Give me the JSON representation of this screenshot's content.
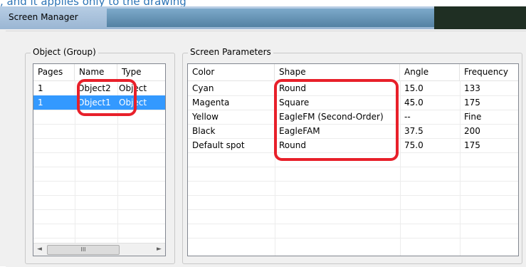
{
  "top_text": ", and it applies only to the drawing",
  "window": {
    "title": "Screen Manager"
  },
  "object_group": {
    "legend": "Object (Group)",
    "columns": [
      "Pages",
      "Name",
      "Type"
    ],
    "rows": [
      {
        "pages": "1",
        "name": "Object2",
        "type": "Object",
        "selected": false
      },
      {
        "pages": "1",
        "name": "Object1",
        "type": "Object",
        "selected": true
      }
    ],
    "scrollbar": {
      "left_arrow": "◄",
      "right_arrow": "►",
      "thumb_grip": "III"
    }
  },
  "screen_parameters": {
    "legend": "Screen Parameters",
    "columns": [
      "Color",
      "Shape",
      "Angle",
      "Frequency"
    ],
    "rows": [
      {
        "color": "Cyan",
        "shape": "Round",
        "angle": "15.0",
        "frequency": "133"
      },
      {
        "color": "Magenta",
        "shape": "Square",
        "angle": "45.0",
        "frequency": "175"
      },
      {
        "color": "Yellow",
        "shape": "EagleFM (Second-Order)",
        "angle": "--",
        "frequency": "Fine"
      },
      {
        "color": "Black",
        "shape": "EagleFAM",
        "angle": "37.5",
        "frequency": "200"
      },
      {
        "color": "Default spot",
        "shape": "Round",
        "angle": "75.0",
        "frequency": "175"
      }
    ]
  },
  "colors": {
    "selection": "#3399ff",
    "highlight_annotation": "#e8202a",
    "link_text": "#2e75b6"
  }
}
